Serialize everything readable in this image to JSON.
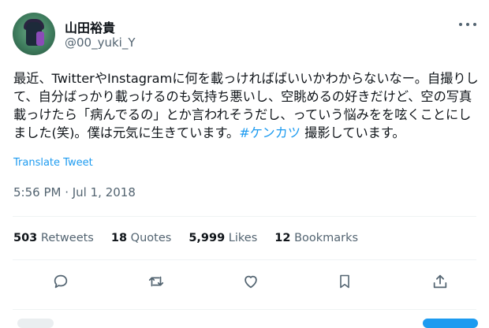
{
  "profile": {
    "display_name": "山田裕貴",
    "handle": "@00_yuki_Y"
  },
  "tweet": {
    "text_before": "最近、TwitterやInstagramに何を載っければばいいかわからないなー。自撮りして、自分ばっかり載っけるのも気持ち悪いし、空眺めるの好きだけど、空の写真載っけたら「病んでるの」とか言われそうだし、っていう悩みをを呟くことにしました(笑)。僕は元気に生きています。",
    "hashtag": "#ケンカツ",
    "text_after": " 撮影しています。",
    "translate_label": "Translate Tweet",
    "timestamp": "5:56 PM · Jul 1, 2018"
  },
  "stats": {
    "retweets": "503",
    "retweets_label": "Retweets",
    "quotes": "18",
    "quotes_label": "Quotes",
    "likes": "5,999",
    "likes_label": "Likes",
    "bookmarks": "12",
    "bookmarks_label": "Bookmarks"
  },
  "actions": [
    "reply-icon",
    "retweet-icon",
    "like-icon",
    "bookmark-icon",
    "share-icon"
  ],
  "colors": {
    "accent": "#1d9bf0",
    "text": "#0f1419",
    "muted": "#536471",
    "divider": "#eff3f4"
  }
}
